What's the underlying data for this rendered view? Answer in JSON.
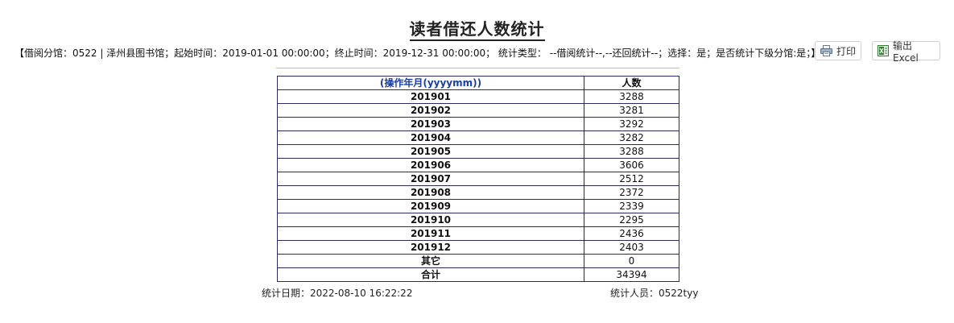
{
  "report": {
    "title": "读者借还人数统计",
    "params": "【借阅分馆：0522 | 泽州县图书馆；起始时间：2019-01-01 00:00:00；终止时间：2019-12-31 00:00:00； 统计类型： --借阅统计--,--还回统计--；选择：是；是否统计下级分馆:是；】",
    "print_label": "打印",
    "excel_label": "输出Excel"
  },
  "table": {
    "headers": [
      "(操作年月(yyyymm))",
      "人数"
    ],
    "rows": [
      [
        "201901",
        "3288"
      ],
      [
        "201902",
        "3281"
      ],
      [
        "201903",
        "3292"
      ],
      [
        "201904",
        "3282"
      ],
      [
        "201905",
        "3288"
      ],
      [
        "201906",
        "3606"
      ],
      [
        "201907",
        "2512"
      ],
      [
        "201908",
        "2372"
      ],
      [
        "201909",
        "2339"
      ],
      [
        "201910",
        "2295"
      ],
      [
        "201911",
        "2436"
      ],
      [
        "201912",
        "2403"
      ],
      [
        "其它",
        "0"
      ],
      [
        "合计",
        "34394"
      ]
    ]
  },
  "footer": {
    "date": "统计日期：2022-08-10 16:22:22",
    "user": "统计人员：0522tyy"
  }
}
